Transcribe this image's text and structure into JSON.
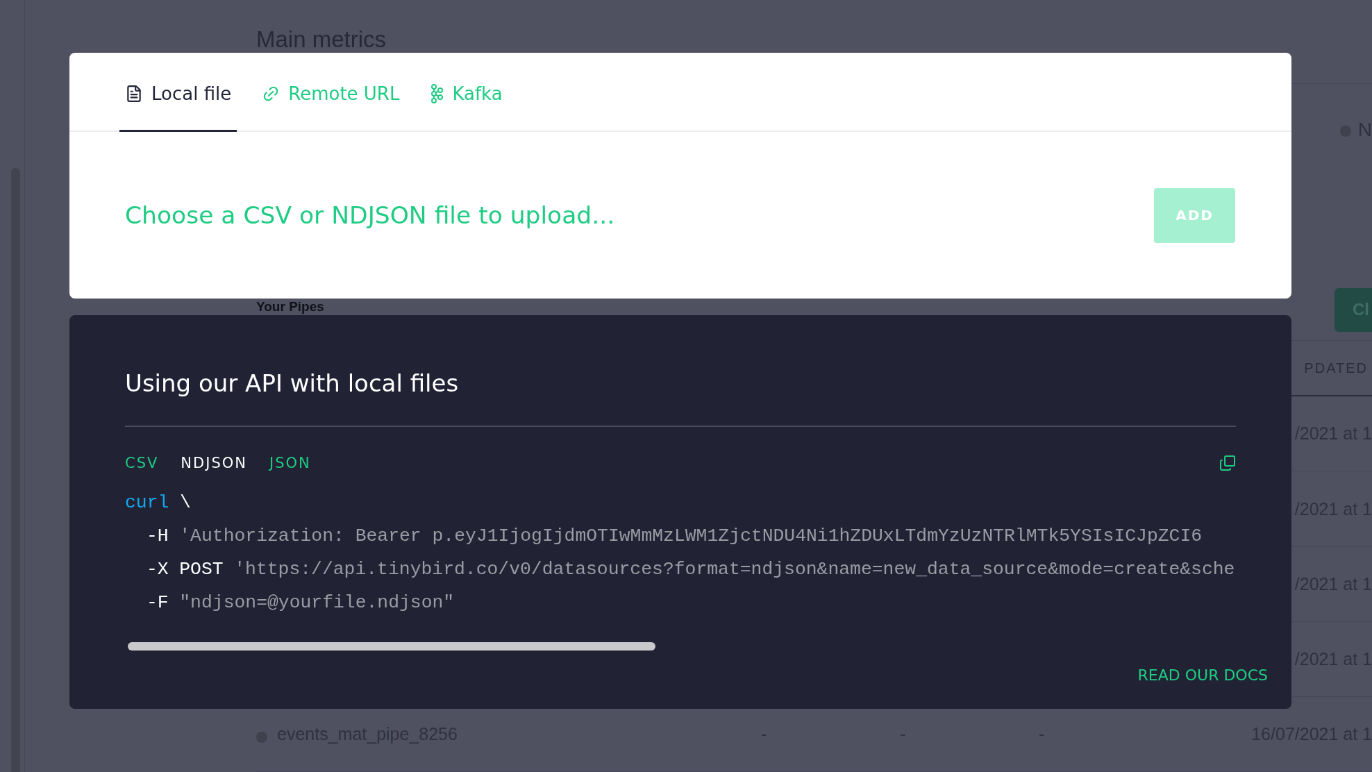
{
  "background": {
    "heading": "Main metrics",
    "status": "N",
    "section_heading": "Your Pipes",
    "create_button": "Cl",
    "table": {
      "column_header": "PDATED",
      "rows": [
        {
          "updated": "/2021 at 1"
        },
        {
          "updated": "/2021 at 1"
        },
        {
          "updated": "/2021 at 1"
        },
        {
          "updated": "/2021 at 1"
        },
        {
          "name": "events_mat_pipe_8256",
          "column_2": "-",
          "column_3": "-",
          "column_4": "-",
          "updated": "16/07/2021 at 1"
        }
      ]
    }
  },
  "modal": {
    "tabs": [
      {
        "label": "Local file",
        "kind": "file",
        "selected": true
      },
      {
        "label": "Remote URL",
        "kind": "link",
        "selected": false
      },
      {
        "label": "Kafka",
        "kind": "kafka",
        "selected": false
      }
    ],
    "upload_prompt": "Choose a CSV or NDJSON file to upload...",
    "add_button": {
      "label": "ADD",
      "disabled": true
    }
  },
  "api_panel": {
    "title": "Using our API with local files",
    "formats": [
      {
        "label": "CSV",
        "selected": false
      },
      {
        "label": "NDJSON",
        "selected": true
      },
      {
        "label": "JSON",
        "selected": false
      }
    ],
    "code_lines": [
      {
        "indent": false,
        "parts": [
          {
            "text": "curl",
            "kind": "command"
          },
          {
            "text": "\\",
            "kind": "plain"
          }
        ]
      },
      {
        "indent": true,
        "parts": [
          {
            "text": "-H",
            "kind": "plain"
          },
          {
            "text": "'Authorization: Bearer p.eyJ1IjogIjdmOTIwMmMzLWM1ZjctNDU4Ni1hZDUxLTdmYzUzNTRlMTk5YSIsICJpZCI6",
            "kind": "string"
          }
        ]
      },
      {
        "indent": true,
        "parts": [
          {
            "text": "-X",
            "kind": "plain"
          },
          {
            "text": "POST",
            "kind": "plain"
          },
          {
            "text": "'https://api.tinybird.co/v0/datasources?format=ndjson&name=new_data_source&mode=create&sche",
            "kind": "string"
          }
        ]
      },
      {
        "indent": true,
        "parts": [
          {
            "text": "-F",
            "kind": "plain"
          },
          {
            "text": "\"ndjson=@yourfile.ndjson\"",
            "kind": "string"
          }
        ]
      }
    ],
    "docs_link": "READ OUR DOCS"
  }
}
